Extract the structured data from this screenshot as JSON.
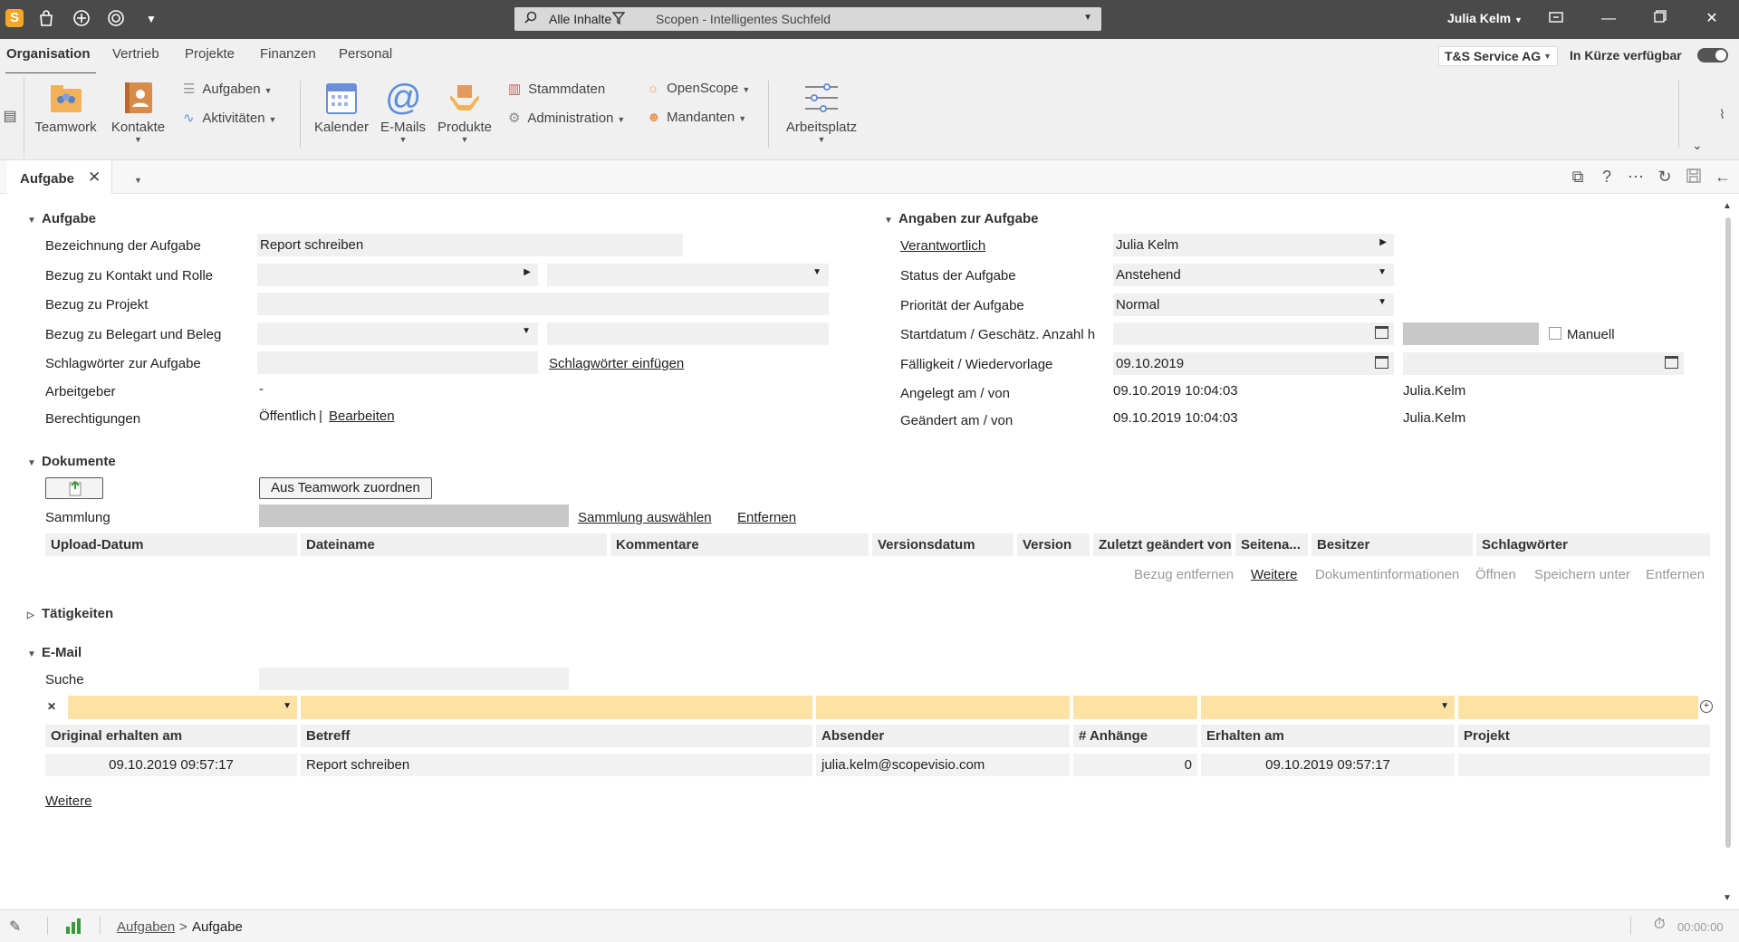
{
  "titlebar": {
    "logo": "S",
    "search_scope": "Alle Inhalte",
    "search_placeholder": "Scopen - Intelligentes Suchfeld",
    "user": "Julia Kelm"
  },
  "menu": {
    "tabs": [
      "Organisation",
      "Vertrieb",
      "Projekte",
      "Finanzen",
      "Personal"
    ],
    "company": "T&S Service AG",
    "soon_label": "In Kürze verfügbar"
  },
  "ribbon": {
    "teamwork": "Teamwork",
    "kontakte": "Kontakte",
    "aufgaben": "Aufgaben",
    "aktivitaeten": "Aktivitäten",
    "kalender": "Kalender",
    "emails": "E-Mails",
    "produkte": "Produkte",
    "stammdaten": "Stammdaten",
    "administration": "Administration",
    "openscope": "OpenScope",
    "mandanten": "Mandanten",
    "arbeitsplatz": "Arbeitsplatz"
  },
  "doctab": {
    "label": "Aufgabe"
  },
  "aufgabe": {
    "title": "Aufgabe",
    "bezeichnung_label": "Bezeichnung der Aufgabe",
    "bezeichnung_value": "Report schreiben",
    "bezug_kontakt_label": "Bezug zu Kontakt und Rolle",
    "bezug_projekt_label": "Bezug zu Projekt",
    "bezug_beleg_label": "Bezug zu Belegart und Beleg",
    "schlagwoerter_label": "Schlagwörter zur Aufgabe",
    "schlagwoerter_link": "Schlagwörter einfügen",
    "arbeitgeber_label": "Arbeitgeber",
    "arbeitgeber_value": "-",
    "berechtigungen_label": "Berechtigungen",
    "berechtigungen_value": "Öffentlich",
    "berechtigungen_sep": "|",
    "berechtigungen_link": "Bearbeiten"
  },
  "angaben": {
    "title": "Angaben zur Aufgabe",
    "verantwortlich_label": "Verantwortlich",
    "verantwortlich_value": "Julia Kelm",
    "status_label": "Status der Aufgabe",
    "status_value": "Anstehend",
    "prioritaet_label": "Priorität der Aufgabe",
    "prioritaet_value": "Normal",
    "start_label": "Startdatum / Geschätz. Anzahl h",
    "manuell_label": "Manuell",
    "faelligkeit_label": "Fälligkeit / Wiedervorlage",
    "faelligkeit_value": "09.10.2019",
    "angelegt_label": "Angelegt am / von",
    "angelegt_value": "09.10.2019 10:04:03",
    "angelegt_by": "Julia.Kelm",
    "geaendert_label": "Geändert am / von",
    "geaendert_value": "09.10.2019 10:04:03",
    "geaendert_by": "Julia.Kelm"
  },
  "dokumente": {
    "title": "Dokumente",
    "teamwork_button": "Aus Teamwork zuordnen",
    "sammlung_label": "Sammlung",
    "sammlung_link": "Sammlung auswählen",
    "entfernen_link": "Entfernen",
    "columns": [
      "Upload-Datum",
      "Dateiname",
      "Kommentare",
      "Versionsdatum",
      "Version",
      "Zuletzt geändert von",
      "Seitena...",
      "Besitzer",
      "Schlagwörter"
    ],
    "actions": [
      "Bezug entfernen",
      "Weitere",
      "Dokumentinformationen",
      "Öffnen",
      "Speichern unter",
      "Entfernen"
    ]
  },
  "taetigkeiten": {
    "title": "Tätigkeiten"
  },
  "email": {
    "title": "E-Mail",
    "suche_label": "Suche",
    "columns": [
      "Original erhalten am",
      "Betreff",
      "Absender",
      "# Anhänge",
      "Erhalten am",
      "Projekt"
    ],
    "rows": [
      {
        "original": "09.10.2019 09:57:17",
        "betreff": "Report schreiben",
        "absender": "julia.kelm@scopevisio.com",
        "anhaenge": "0",
        "erhalten": "09.10.2019 09:57:17",
        "projekt": ""
      }
    ],
    "weitere": "Weitere"
  },
  "statusbar": {
    "breadcrumb_link": "Aufgaben",
    "breadcrumb_sep": ">",
    "breadcrumb_current": "Aufgabe",
    "timer": "00:00:00"
  }
}
